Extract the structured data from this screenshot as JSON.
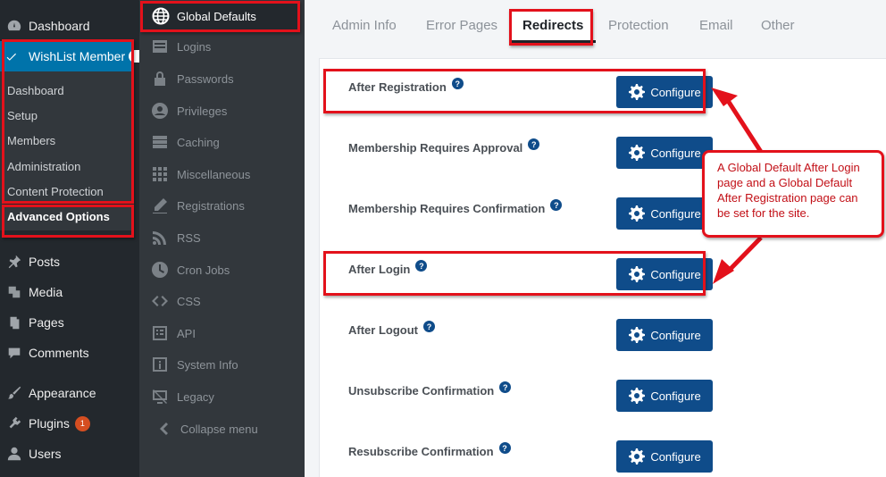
{
  "wp_sidebar": {
    "dashboard": "Dashboard",
    "wishlist_member": "WishList Member",
    "submenu": [
      "Dashboard",
      "Setup",
      "Members",
      "Administration",
      "Content Protection"
    ],
    "advanced_options": "Advanced Options",
    "posts": "Posts",
    "media": "Media",
    "pages": "Pages",
    "comments": "Comments",
    "appearance": "Appearance",
    "plugins": "Plugins",
    "plugins_badge": "1",
    "users": "Users"
  },
  "wlm_sidebar": {
    "global_defaults": "Global Defaults",
    "items": [
      "Logins",
      "Passwords",
      "Privileges",
      "Caching",
      "Miscellaneous",
      "Registrations",
      "RSS",
      "Cron Jobs",
      "CSS",
      "API",
      "System Info",
      "Legacy"
    ],
    "collapse": "Collapse menu"
  },
  "tabs": [
    "Admin Info",
    "Error Pages",
    "Redirects",
    "Protection",
    "Email",
    "Other"
  ],
  "active_tab": "Redirects",
  "redirects": [
    {
      "label": "After Registration",
      "button": "Configure"
    },
    {
      "label": "Membership Requires Approval",
      "button": "Configure"
    },
    {
      "label": "Membership Requires Confirmation",
      "button": "Configure"
    },
    {
      "label": "After Login",
      "button": "Configure"
    },
    {
      "label": "After Logout",
      "button": "Configure"
    },
    {
      "label": "Unsubscribe Confirmation",
      "button": "Configure"
    },
    {
      "label": "Resubscribe Confirmation",
      "button": "Configure"
    }
  ],
  "help_glyph": "?",
  "callout_text": "A Global Default After Login page and a Global Default After Registration page can be set for the site.",
  "colors": {
    "accent": "#0f4c8a",
    "annotation": "#e3111b",
    "wp_active": "#0073aa"
  }
}
